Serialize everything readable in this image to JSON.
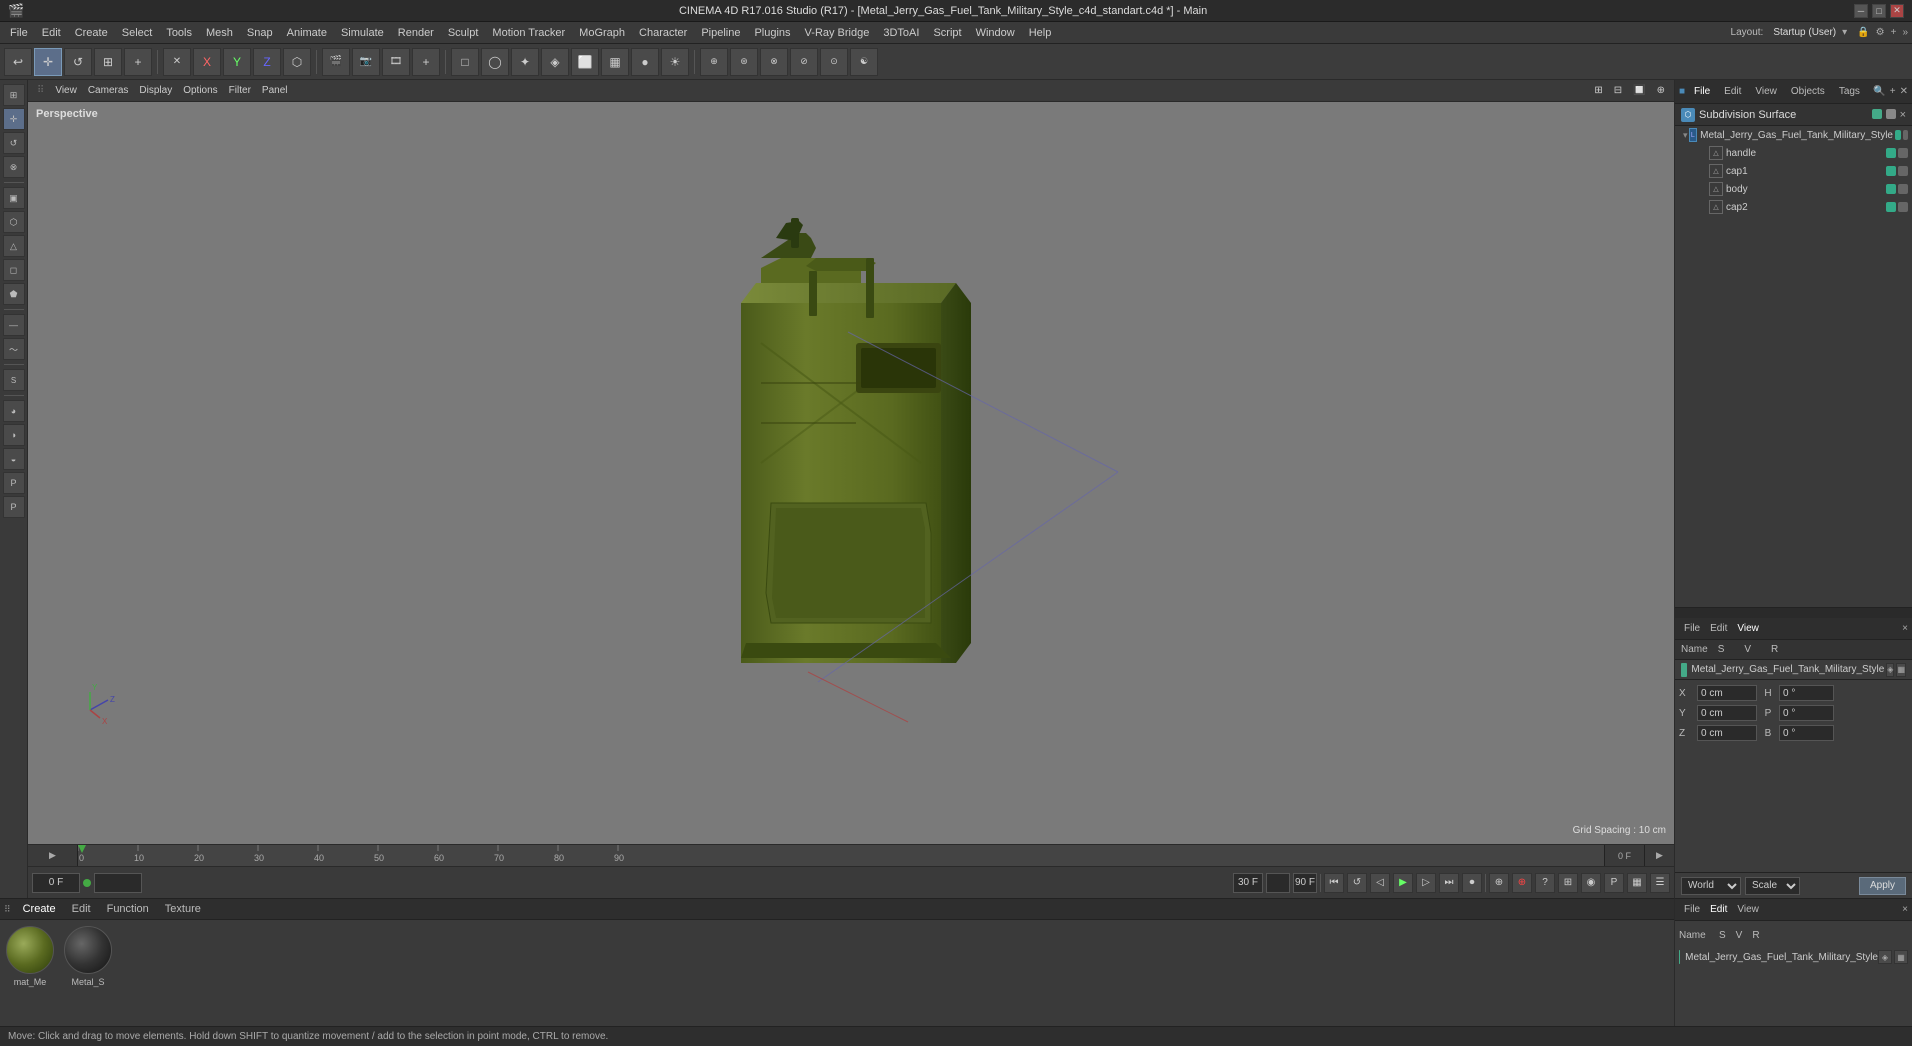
{
  "window": {
    "title": "CINEMA 4D R17.016 Studio (R17) - [Metal_Jerry_Gas_Fuel_Tank_Military_Style_c4d_standart.c4d *] - Main"
  },
  "menu": {
    "items": [
      "File",
      "Edit",
      "Create",
      "Select",
      "Tools",
      "Mesh",
      "Snap",
      "Animate",
      "Simulate",
      "Render",
      "Sculpt",
      "Motion Tracker",
      "MoGraph",
      "Character",
      "Pipeline",
      "Plugins",
      "V-Ray Bridge",
      "3DToAI",
      "Script",
      "Window",
      "Help"
    ]
  },
  "layout": {
    "name": "Startup (User)"
  },
  "viewport": {
    "label": "Perspective",
    "grid_spacing": "Grid Spacing : 10 cm"
  },
  "scene_panel": {
    "tabs": [
      "File",
      "Edit",
      "View",
      "Objects",
      "Tags"
    ],
    "subdivision_surface_label": "Subdivision Surface",
    "model_name": "Metal_Jerry_Gas_Fuel_Tank_Military_Style",
    "tree_items": [
      {
        "name": "handle",
        "indent": 1
      },
      {
        "name": "cap1",
        "indent": 1
      },
      {
        "name": "body",
        "indent": 1
      },
      {
        "name": "cap2",
        "indent": 1
      }
    ]
  },
  "attr_panel": {
    "tabs": [
      "File",
      "Edit",
      "View"
    ],
    "name_label": "Name",
    "name_cols": [
      "S",
      "V",
      "R"
    ],
    "filename": "Metal_Jerry_Gas_Fuel_Tank_Military_Style",
    "coords": {
      "x_label": "X",
      "x_val": "0 cm",
      "h_label": "H",
      "h_val": "0 °",
      "y_label": "Y",
      "y_val": "0 cm",
      "p_label": "P",
      "p_val": "0 °",
      "z_label": "Z",
      "z_val": "0 cm",
      "b_label": "B",
      "b_val": "0 °"
    },
    "world_label": "World",
    "scale_label": "Scale",
    "apply_label": "Apply"
  },
  "materials": {
    "tabs": [
      "Create",
      "Edit",
      "Function",
      "Texture"
    ],
    "items": [
      {
        "name": "mat_Me",
        "type": "green"
      },
      {
        "name": "Metal_S",
        "type": "dark"
      }
    ]
  },
  "timeline": {
    "current_frame": "0 F",
    "end_frame": "90 F",
    "fps": "30 F",
    "ticks": [
      "0",
      "10",
      "20",
      "30",
      "40",
      "50",
      "60",
      "70",
      "80",
      "90"
    ]
  },
  "toolbar": {
    "tools": [
      "↩",
      "↺",
      "⟳",
      "+",
      "↕"
    ],
    "mode_tools": [
      "×",
      "Y",
      "Z",
      "⬡"
    ],
    "view_tools": [
      "□",
      "◯",
      "✦",
      "◈",
      "⬜",
      "▦",
      "●",
      "☀"
    ]
  },
  "status_bar": {
    "message": "Move: Click and drag to move elements. Hold down SHIFT to quantize movement / add to the selection in point mode, CTRL to remove."
  },
  "playback": {
    "controls": [
      "⏮",
      "↺",
      "⏪",
      "▶",
      "⏩",
      "⏭"
    ]
  }
}
